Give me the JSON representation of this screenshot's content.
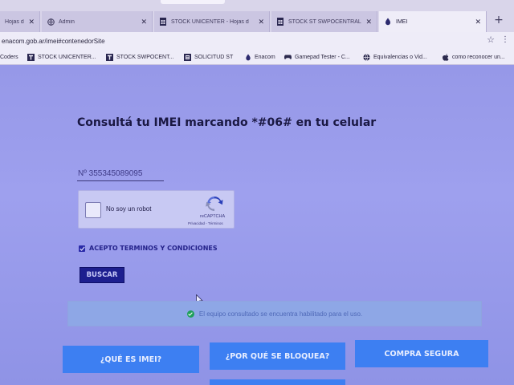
{
  "browser": {
    "tabs": [
      {
        "label": "Hojas d",
        "icon": "sheets-icon",
        "active": false
      },
      {
        "label": "Admin",
        "icon": "globe-icon",
        "active": false
      },
      {
        "label": "STOCK UNICENTER - Hojas d",
        "icon": "sheets-icon",
        "active": false
      },
      {
        "label": "STOCK ST SWPOCENTRAL - C",
        "icon": "sheets-icon",
        "active": false
      },
      {
        "label": "IMEI",
        "icon": "enacom-icon",
        "active": true
      }
    ],
    "new_tab": "+",
    "url": "enacom.gob.ar/imei#contenedorSite",
    "bookmarks": [
      {
        "label": "Coders",
        "icon": ""
      },
      {
        "label": "STOCK UNICENTER...",
        "icon": "sheets-icon"
      },
      {
        "label": "STOCK SWPOCENT...",
        "icon": "sheets-icon"
      },
      {
        "label": "SOLICITUD ST",
        "icon": "form-icon"
      },
      {
        "label": "Enacom",
        "icon": "enacom-icon"
      },
      {
        "label": "Gamepad Tester - C...",
        "icon": "gamepad-icon"
      },
      {
        "label": "Equivalencias o Vid...",
        "icon": "globe-icon"
      },
      {
        "label": "como reconocer un...",
        "icon": "apple-icon"
      }
    ]
  },
  "page": {
    "headline": "Consultá tu IMEI marcando *#06# en tu celular",
    "imei_value": "Nº 355345089095",
    "captcha": {
      "label": "No soy un robot",
      "brand": "reCAPTCHA",
      "links": "Privacidad - Términos"
    },
    "terms_label": "ACEPTO TERMINOS Y CONDICIONES",
    "search_button": "BUSCAR",
    "result_message": "El equipo consultado se encuentra habilitado para el uso.",
    "nav_buttons": [
      "¿QUÉ ES IMEI?",
      "¿POR QUÉ SE BLOQUEA?",
      "COMPRA SEGURA"
    ]
  },
  "colors": {
    "page_bg": "#9698e8",
    "headline": "#1a1843",
    "button_dark": "#1d1f8f",
    "nav_button": "#3d7ff2",
    "success_icon": "#1f9f5a"
  }
}
